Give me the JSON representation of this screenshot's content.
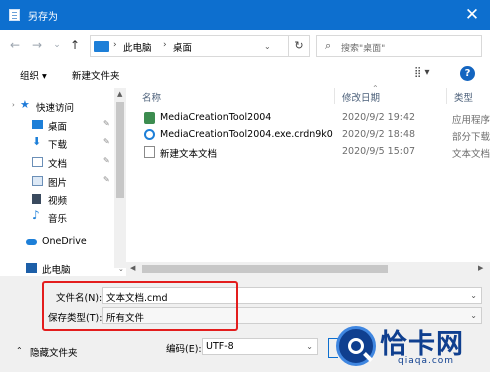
{
  "window": {
    "title": "另存为",
    "close_glyph": "✕"
  },
  "nav": {
    "back_glyph": "←",
    "forward_glyph": "→",
    "dropdown_glyph": "⌄",
    "up_glyph": "↑",
    "breadcrumb": [
      "此电脑",
      "桌面"
    ],
    "breadcrumb_sep": "›",
    "refresh_glyph": "↻",
    "search_placeholder": "搜索\"桌面\""
  },
  "toolbar": {
    "organize": "组织 ▾",
    "new_folder": "新建文件夹",
    "view_glyph": "⣿ ▾",
    "help": "?"
  },
  "sidebar": {
    "items": [
      {
        "label": "快速访问",
        "icon": "star-icon"
      },
      {
        "label": "桌面",
        "icon": "desktop-icon",
        "pinned": true
      },
      {
        "label": "下载",
        "icon": "download-icon",
        "pinned": true
      },
      {
        "label": "文档",
        "icon": "document-icon",
        "pinned": true
      },
      {
        "label": "图片",
        "icon": "picture-icon",
        "pinned": true
      },
      {
        "label": "视频",
        "icon": "video-icon"
      },
      {
        "label": "音乐",
        "icon": "music-icon"
      },
      {
        "label": "OneDrive",
        "icon": "cloud-icon"
      },
      {
        "label": "此电脑",
        "icon": "computer-icon"
      }
    ],
    "pin_glyph": "📌"
  },
  "columns": {
    "name": "名称",
    "date": "修改日期",
    "type": "类型"
  },
  "files": [
    {
      "name": "MediaCreationTool2004",
      "date": "2020/9/2 19:42",
      "type": "应用程序"
    },
    {
      "name": "MediaCreationTool2004.exe.crdn9k0",
      "date": "2020/9/2 18:48",
      "type": "部分下载"
    },
    {
      "name": "新建文本文档",
      "date": "2020/9/5 15:07",
      "type": "文本文档"
    }
  ],
  "form": {
    "filename_label": "文件名(N):",
    "filename_value": "文本文档.cmd",
    "filetype_label": "保存类型(T):",
    "filetype_value": "所有文件",
    "hide_folders": "隐藏文件夹",
    "encoding_label": "编码(E):",
    "encoding_value": "UTF-8"
  },
  "watermark": {
    "text": "恰卡网",
    "url": "qiaqa.com"
  },
  "colors": {
    "titlebar": "#0d6fcf",
    "highlight_border": "#e31d1d",
    "watermark": "#0f3f8f"
  }
}
